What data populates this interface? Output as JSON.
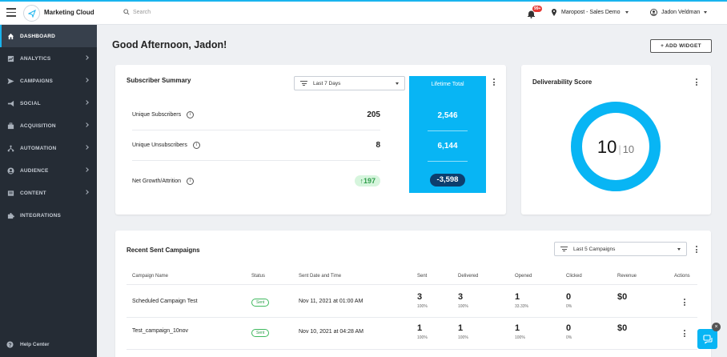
{
  "app": {
    "brand": "Marketing Cloud",
    "search_placeholder": "Search",
    "notification_count": "99+",
    "account": "Maropost - Sales Demo",
    "user": "Jadon Veldman",
    "accent": "#08b5f4"
  },
  "sidebar": {
    "items": [
      {
        "label": "DASHBOARD",
        "icon": "home-icon",
        "active": true
      },
      {
        "label": "ANALYTICS",
        "icon": "analytics-icon"
      },
      {
        "label": "CAMPAIGNS",
        "icon": "send-icon"
      },
      {
        "label": "SOCIAL",
        "icon": "megaphone-icon"
      },
      {
        "label": "ACQUISITION",
        "icon": "briefcase-icon"
      },
      {
        "label": "AUTOMATION",
        "icon": "automation-icon"
      },
      {
        "label": "AUDIENCE",
        "icon": "audience-icon"
      },
      {
        "label": "CONTENT",
        "icon": "content-icon"
      },
      {
        "label": "INTEGRATIONS",
        "icon": "puzzle-icon"
      }
    ],
    "help_center": "Help Center"
  },
  "main": {
    "greeting": "Good Afternoon, Jadon!",
    "add_widget": "+ ADD WIDGET"
  },
  "subscriber_summary": {
    "title": "Subscriber Summary",
    "range": "Last 7 Days",
    "rows": [
      {
        "label": "Unique Subscribers",
        "value": "205"
      },
      {
        "label": "Unique Unsubscribers",
        "value": "8"
      },
      {
        "label": "Net Growth/Attrition",
        "value": "↑197"
      }
    ],
    "lifetime": {
      "header": "Lifetime Total",
      "subscribers": "2,546",
      "unsubscribers": "6,144",
      "net": "-3,598"
    }
  },
  "deliverability": {
    "title": "Deliverability Score",
    "score": "10",
    "max": "10",
    "score_fraction": 1.0
  },
  "recent_campaigns": {
    "title": "Recent Sent Campaigns",
    "range": "Last 5 Campaigns",
    "columns": [
      "Campaign Name",
      "Status",
      "Sent Date and Time",
      "Sent",
      "Delivered",
      "Opened",
      "Clicked",
      "Revenue",
      "Actions"
    ],
    "rows": [
      {
        "name": "Scheduled Campaign Test",
        "status": "Sent",
        "date": "Nov 11, 2021 at 01:00 AM",
        "sent": "3",
        "sent_pct": "100%",
        "delivered": "3",
        "delivered_pct": "100%",
        "opened": "1",
        "opened_pct": "33.33%",
        "clicked": "0",
        "clicked_pct": "0%",
        "revenue": "$0"
      },
      {
        "name": "Test_campaign_10nov",
        "status": "Sent",
        "date": "Nov 10, 2021 at 04:28 AM",
        "sent": "1",
        "sent_pct": "100%",
        "delivered": "1",
        "delivered_pct": "100%",
        "opened": "1",
        "opened_pct": "100%",
        "clicked": "0",
        "clicked_pct": "0%",
        "revenue": "$0"
      }
    ]
  }
}
